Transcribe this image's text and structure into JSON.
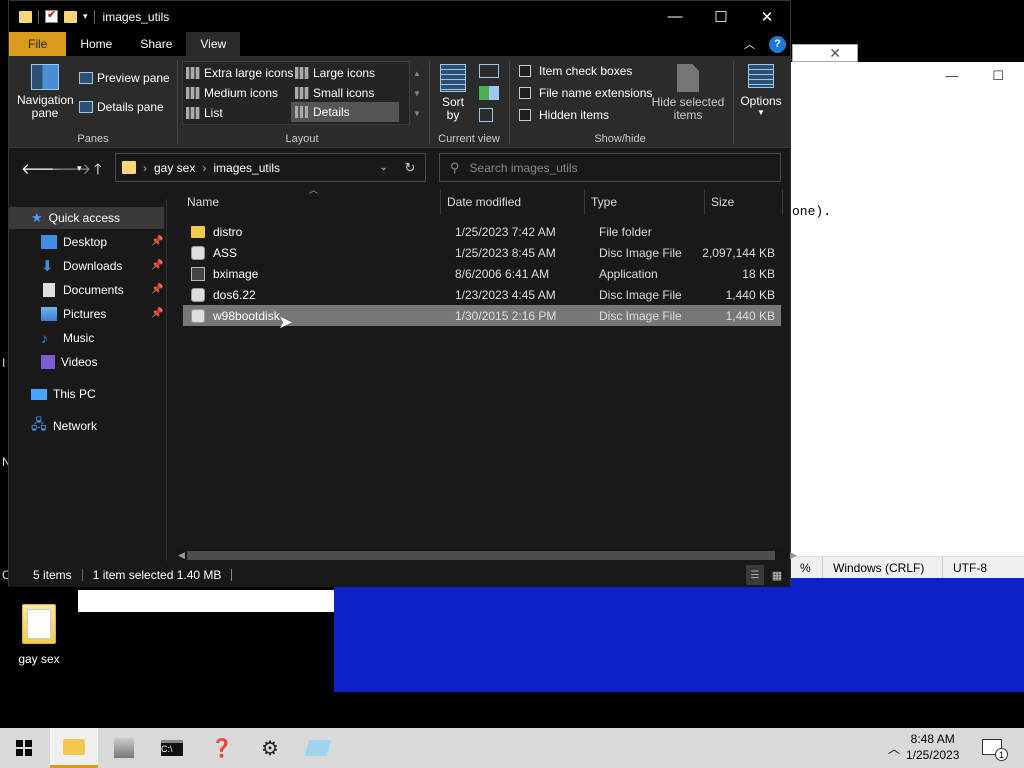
{
  "window": {
    "title": "images_utils"
  },
  "tabs": [
    {
      "label": "File"
    },
    {
      "label": "Home"
    },
    {
      "label": "Share"
    },
    {
      "label": "View"
    }
  ],
  "ribbon": {
    "panes": {
      "navigation_pane": "Navigation pane",
      "preview_pane": "Preview pane",
      "details_pane": "Details pane",
      "group": "Panes"
    },
    "layout": {
      "extra_large": "Extra large icons",
      "large": "Large icons",
      "medium": "Medium icons",
      "small": "Small icons",
      "list": "List",
      "details": "Details",
      "group": "Layout"
    },
    "current_view": {
      "sort_by": "Sort by",
      "group": "Current view"
    },
    "show_hide": {
      "item_check_boxes": "Item check boxes",
      "file_name_extensions": "File name extensions",
      "hidden_items": "Hidden items",
      "hide_selected": "Hide selected items",
      "group": "Show/hide"
    },
    "options": "Options"
  },
  "address": {
    "crumbs": [
      "gay sex",
      "images_utils"
    ],
    "search_placeholder": "Search images_utils"
  },
  "sidebar": {
    "quick_access": "Quick access",
    "items": [
      {
        "label": "Desktop",
        "pinned": true
      },
      {
        "label": "Downloads",
        "pinned": true
      },
      {
        "label": "Documents",
        "pinned": true
      },
      {
        "label": "Pictures",
        "pinned": true
      },
      {
        "label": "Music",
        "pinned": false
      },
      {
        "label": "Videos",
        "pinned": false
      }
    ],
    "this_pc": "This PC",
    "network": "Network"
  },
  "columns": {
    "name": "Name",
    "date": "Date modified",
    "type": "Type",
    "size": "Size"
  },
  "files": [
    {
      "name": "distro",
      "date": "1/25/2023 7:42 AM",
      "type": "File folder",
      "size": "",
      "icon": "folder-icon"
    },
    {
      "name": "ASS",
      "date": "1/25/2023 8:45 AM",
      "type": "Disc Image File",
      "size": "2,097,144 KB",
      "icon": "disc-image-icon"
    },
    {
      "name": "bximage",
      "date": "8/6/2006 6:41 AM",
      "type": "Application",
      "size": "18 KB",
      "icon": "application-icon"
    },
    {
      "name": "dos6.22",
      "date": "1/23/2023 4:45 AM",
      "type": "Disc Image File",
      "size": "1,440 KB",
      "icon": "disc-image-icon"
    },
    {
      "name": "w98bootdisk",
      "date": "1/30/2015 2:16 PM",
      "type": "Disc Image File",
      "size": "1,440 KB",
      "icon": "disc-image-icon",
      "selected": true
    }
  ],
  "status": {
    "items": "5 items",
    "selected": "1 item selected  1.40 MB"
  },
  "background": {
    "notepad_text": "one).",
    "notepad_status": [
      "%",
      "Windows (CRLF)",
      "UTF-8"
    ],
    "desktop_icon_label": "gay sex",
    "left_edge_chars": [
      "C",
      "I",
      "N"
    ]
  },
  "taskbar": {
    "time": "8:48 AM",
    "date": "1/25/2023",
    "notification_count": "1"
  },
  "colors": {
    "file_tab": "#d89b1c",
    "selection": "#777777",
    "accent_blue": "#1d77d6",
    "background_blue": "#0d23c8"
  }
}
